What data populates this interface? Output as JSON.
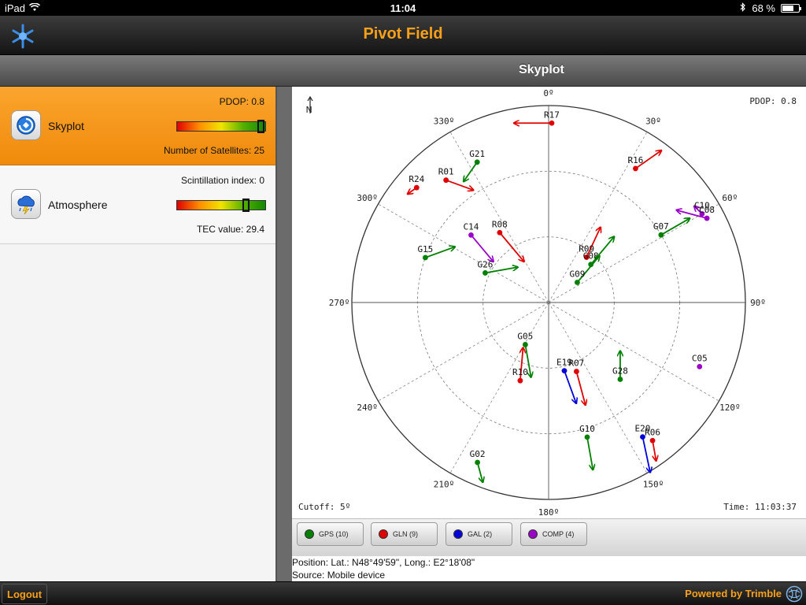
{
  "status_bar": {
    "device": "iPad",
    "time": "11:04",
    "battery_text": "68 %",
    "battery_level": 0.68
  },
  "header": {
    "title": "Pivot Field",
    "subtitle": "Skyplot"
  },
  "sidebar": {
    "items": [
      {
        "label": "Skyplot",
        "icon": "skyplot-icon",
        "top_stat": "PDOP: 0.8",
        "bottom_stat": "Number of Satellites: 25",
        "gauge_level": 0.95,
        "active": true
      },
      {
        "label": "Atmosphere",
        "icon": "storm-cloud-icon",
        "top_stat": "Scintillation index: 0",
        "bottom_stat": "TEC value: 29.4",
        "gauge_level": 0.78,
        "active": false
      }
    ]
  },
  "skyplot": {
    "north_label": "N",
    "pdop": "PDOP: 0.8",
    "cutoff": "Cutoff: 5º",
    "time": "Time: 11:03:37",
    "azimuth_labels": [
      "0º",
      "30º",
      "60º",
      "90º",
      "120º",
      "150º",
      "180º",
      "210º",
      "240º",
      "270º",
      "300º",
      "330º"
    ],
    "constellation_colors": {
      "GPS": "#008000",
      "GLN": "#e00000",
      "GAL": "#0000d8",
      "COMP": "#9a00c8"
    },
    "satellites": [
      {
        "id": "R17",
        "sys": "GLN",
        "az": 1,
        "el": 8,
        "dir": 270,
        "len": 48
      },
      {
        "id": "G21",
        "sys": "GPS",
        "az": 333,
        "el": 18,
        "dir": 215,
        "len": 30
      },
      {
        "id": "R01",
        "sys": "GLN",
        "az": 320,
        "el": 17,
        "dir": 110,
        "len": 37
      },
      {
        "id": "R24",
        "sys": "GLN",
        "az": 311,
        "el": 10,
        "dir": 235,
        "len": 14
      },
      {
        "id": "R16",
        "sys": "GLN",
        "az": 33,
        "el": 17,
        "dir": 55,
        "len": 40
      },
      {
        "id": "C10",
        "sys": "COMP",
        "az": 60,
        "el": 9,
        "dir": 315,
        "len": 14
      },
      {
        "id": "C08",
        "sys": "COMP",
        "az": 62,
        "el": 8,
        "dir": 285,
        "len": 40
      },
      {
        "id": "G07",
        "sys": "GPS",
        "az": 59,
        "el": 30,
        "dir": 60,
        "len": 42
      },
      {
        "id": "C14",
        "sys": "COMP",
        "az": 311,
        "el": 43,
        "dir": 140,
        "len": 44
      },
      {
        "id": "R08",
        "sys": "GLN",
        "az": 325,
        "el": 51,
        "dir": 140,
        "len": 48
      },
      {
        "id": "G15",
        "sys": "GPS",
        "az": 290,
        "el": 30,
        "dir": 70,
        "len": 40
      },
      {
        "id": "G26",
        "sys": "GPS",
        "az": 295,
        "el": 58,
        "dir": 80,
        "len": 42
      },
      {
        "id": "R09",
        "sys": "GLN",
        "az": 40,
        "el": 63,
        "dir": 25,
        "len": 42
      },
      {
        "id": "G08",
        "sys": "GPS",
        "az": 48,
        "el": 64,
        "dir": 40,
        "len": 46
      },
      {
        "id": "G09",
        "sys": "GPS",
        "az": 55,
        "el": 74,
        "dir": 40,
        "len": 44
      },
      {
        "id": "G05",
        "sys": "GPS",
        "az": 209,
        "el": 68,
        "dir": 170,
        "len": 42
      },
      {
        "id": "R10",
        "sys": "GLN",
        "az": 200,
        "el": 52,
        "dir": 5,
        "len": 42
      },
      {
        "id": "E19",
        "sys": "GAL",
        "az": 167,
        "el": 58,
        "dir": 160,
        "len": 44
      },
      {
        "id": "R07",
        "sys": "GLN",
        "az": 158,
        "el": 56,
        "dir": 165,
        "len": 44
      },
      {
        "id": "G28",
        "sys": "GPS",
        "az": 137,
        "el": 42,
        "dir": 0,
        "len": 36
      },
      {
        "id": "C05",
        "sys": "COMP",
        "az": 113,
        "el": 15,
        "dir": 0,
        "len": 0
      },
      {
        "id": "G10",
        "sys": "GPS",
        "az": 164,
        "el": 26,
        "dir": 170,
        "len": 42
      },
      {
        "id": "E20",
        "sys": "GAL",
        "az": 145,
        "el": 15,
        "dir": 168,
        "len": 46
      },
      {
        "id": "R06",
        "sys": "GLN",
        "az": 143,
        "el": 11,
        "dir": 170,
        "len": 26
      },
      {
        "id": "G02",
        "sys": "GPS",
        "az": 204,
        "el": 10,
        "dir": 165,
        "len": 26
      }
    ]
  },
  "legend": [
    {
      "label": "GPS (10)",
      "color": "#008000"
    },
    {
      "label": "GLN (9)",
      "color": "#e00000"
    },
    {
      "label": "GAL (2)",
      "color": "#0000d8"
    },
    {
      "label": "COMP (4)",
      "color": "#9a00c8"
    }
  ],
  "info": {
    "position": "Position: Lat.: N48°49'59\", Long.: E2°18'08\"",
    "source": "Source: Mobile device"
  },
  "footer": {
    "logout": "Logout",
    "powered_by": "Powered by Trimble"
  }
}
